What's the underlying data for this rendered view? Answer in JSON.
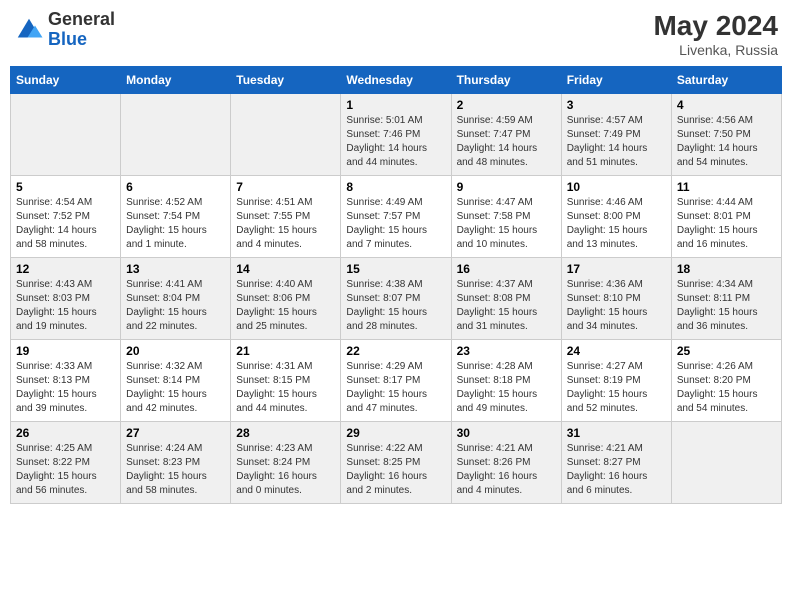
{
  "logo": {
    "general": "General",
    "blue": "Blue"
  },
  "title": {
    "month_year": "May 2024",
    "location": "Livenka, Russia"
  },
  "headers": [
    "Sunday",
    "Monday",
    "Tuesday",
    "Wednesday",
    "Thursday",
    "Friday",
    "Saturday"
  ],
  "weeks": [
    [
      {
        "day": "",
        "info": ""
      },
      {
        "day": "",
        "info": ""
      },
      {
        "day": "",
        "info": ""
      },
      {
        "day": "1",
        "info": "Sunrise: 5:01 AM\nSunset: 7:46 PM\nDaylight: 14 hours\nand 44 minutes."
      },
      {
        "day": "2",
        "info": "Sunrise: 4:59 AM\nSunset: 7:47 PM\nDaylight: 14 hours\nand 48 minutes."
      },
      {
        "day": "3",
        "info": "Sunrise: 4:57 AM\nSunset: 7:49 PM\nDaylight: 14 hours\nand 51 minutes."
      },
      {
        "day": "4",
        "info": "Sunrise: 4:56 AM\nSunset: 7:50 PM\nDaylight: 14 hours\nand 54 minutes."
      }
    ],
    [
      {
        "day": "5",
        "info": "Sunrise: 4:54 AM\nSunset: 7:52 PM\nDaylight: 14 hours\nand 58 minutes."
      },
      {
        "day": "6",
        "info": "Sunrise: 4:52 AM\nSunset: 7:54 PM\nDaylight: 15 hours\nand 1 minute."
      },
      {
        "day": "7",
        "info": "Sunrise: 4:51 AM\nSunset: 7:55 PM\nDaylight: 15 hours\nand 4 minutes."
      },
      {
        "day": "8",
        "info": "Sunrise: 4:49 AM\nSunset: 7:57 PM\nDaylight: 15 hours\nand 7 minutes."
      },
      {
        "day": "9",
        "info": "Sunrise: 4:47 AM\nSunset: 7:58 PM\nDaylight: 15 hours\nand 10 minutes."
      },
      {
        "day": "10",
        "info": "Sunrise: 4:46 AM\nSunset: 8:00 PM\nDaylight: 15 hours\nand 13 minutes."
      },
      {
        "day": "11",
        "info": "Sunrise: 4:44 AM\nSunset: 8:01 PM\nDaylight: 15 hours\nand 16 minutes."
      }
    ],
    [
      {
        "day": "12",
        "info": "Sunrise: 4:43 AM\nSunset: 8:03 PM\nDaylight: 15 hours\nand 19 minutes."
      },
      {
        "day": "13",
        "info": "Sunrise: 4:41 AM\nSunset: 8:04 PM\nDaylight: 15 hours\nand 22 minutes."
      },
      {
        "day": "14",
        "info": "Sunrise: 4:40 AM\nSunset: 8:06 PM\nDaylight: 15 hours\nand 25 minutes."
      },
      {
        "day": "15",
        "info": "Sunrise: 4:38 AM\nSunset: 8:07 PM\nDaylight: 15 hours\nand 28 minutes."
      },
      {
        "day": "16",
        "info": "Sunrise: 4:37 AM\nSunset: 8:08 PM\nDaylight: 15 hours\nand 31 minutes."
      },
      {
        "day": "17",
        "info": "Sunrise: 4:36 AM\nSunset: 8:10 PM\nDaylight: 15 hours\nand 34 minutes."
      },
      {
        "day": "18",
        "info": "Sunrise: 4:34 AM\nSunset: 8:11 PM\nDaylight: 15 hours\nand 36 minutes."
      }
    ],
    [
      {
        "day": "19",
        "info": "Sunrise: 4:33 AM\nSunset: 8:13 PM\nDaylight: 15 hours\nand 39 minutes."
      },
      {
        "day": "20",
        "info": "Sunrise: 4:32 AM\nSunset: 8:14 PM\nDaylight: 15 hours\nand 42 minutes."
      },
      {
        "day": "21",
        "info": "Sunrise: 4:31 AM\nSunset: 8:15 PM\nDaylight: 15 hours\nand 44 minutes."
      },
      {
        "day": "22",
        "info": "Sunrise: 4:29 AM\nSunset: 8:17 PM\nDaylight: 15 hours\nand 47 minutes."
      },
      {
        "day": "23",
        "info": "Sunrise: 4:28 AM\nSunset: 8:18 PM\nDaylight: 15 hours\nand 49 minutes."
      },
      {
        "day": "24",
        "info": "Sunrise: 4:27 AM\nSunset: 8:19 PM\nDaylight: 15 hours\nand 52 minutes."
      },
      {
        "day": "25",
        "info": "Sunrise: 4:26 AM\nSunset: 8:20 PM\nDaylight: 15 hours\nand 54 minutes."
      }
    ],
    [
      {
        "day": "26",
        "info": "Sunrise: 4:25 AM\nSunset: 8:22 PM\nDaylight: 15 hours\nand 56 minutes."
      },
      {
        "day": "27",
        "info": "Sunrise: 4:24 AM\nSunset: 8:23 PM\nDaylight: 15 hours\nand 58 minutes."
      },
      {
        "day": "28",
        "info": "Sunrise: 4:23 AM\nSunset: 8:24 PM\nDaylight: 16 hours\nand 0 minutes."
      },
      {
        "day": "29",
        "info": "Sunrise: 4:22 AM\nSunset: 8:25 PM\nDaylight: 16 hours\nand 2 minutes."
      },
      {
        "day": "30",
        "info": "Sunrise: 4:21 AM\nSunset: 8:26 PM\nDaylight: 16 hours\nand 4 minutes."
      },
      {
        "day": "31",
        "info": "Sunrise: 4:21 AM\nSunset: 8:27 PM\nDaylight: 16 hours\nand 6 minutes."
      },
      {
        "day": "",
        "info": ""
      }
    ]
  ]
}
